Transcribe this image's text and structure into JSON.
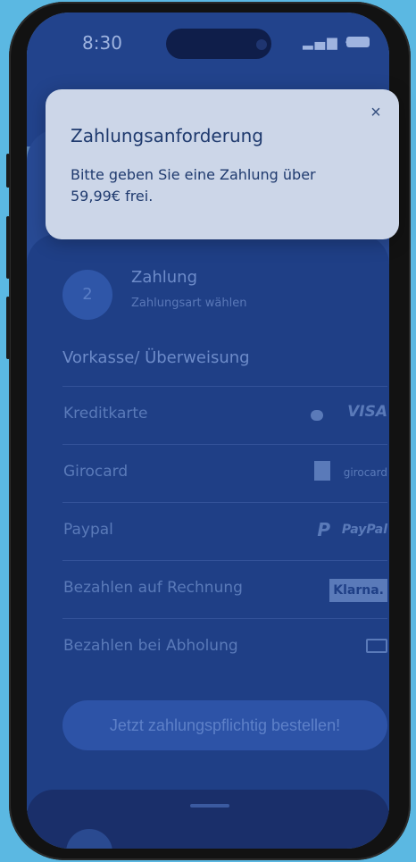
{
  "status_bar": {
    "time": "8:30"
  },
  "step": {
    "number": "2",
    "title": "Zahlung",
    "subtitle": "Zahlungsart wählen"
  },
  "payment": {
    "section_title": "Vorkasse/ Überweisung",
    "options": [
      {
        "label": "Kreditkarte",
        "logo": "VISA"
      },
      {
        "label": "Girocard",
        "logo": "girocard"
      },
      {
        "label": "Paypal",
        "logo": "PayPal"
      },
      {
        "label": "Bezahlen auf Rechnung",
        "logo": "Klarna."
      },
      {
        "label": "Bezahlen bei Abholung",
        "logo": "cash-icon"
      }
    ]
  },
  "order_button": {
    "label": "Jetzt zahlungspflichtig bestellen!"
  },
  "notification": {
    "title": "Zahlungsanforderung",
    "body": "Bitte geben Sie eine Zahlung über 59,99€ frei.",
    "close_glyph": "×"
  },
  "colors": {
    "background": "#5bb8e2",
    "overlay": "#22438c",
    "notification_bg": "#ccd6e8",
    "notification_text": "#1f3a6e"
  }
}
